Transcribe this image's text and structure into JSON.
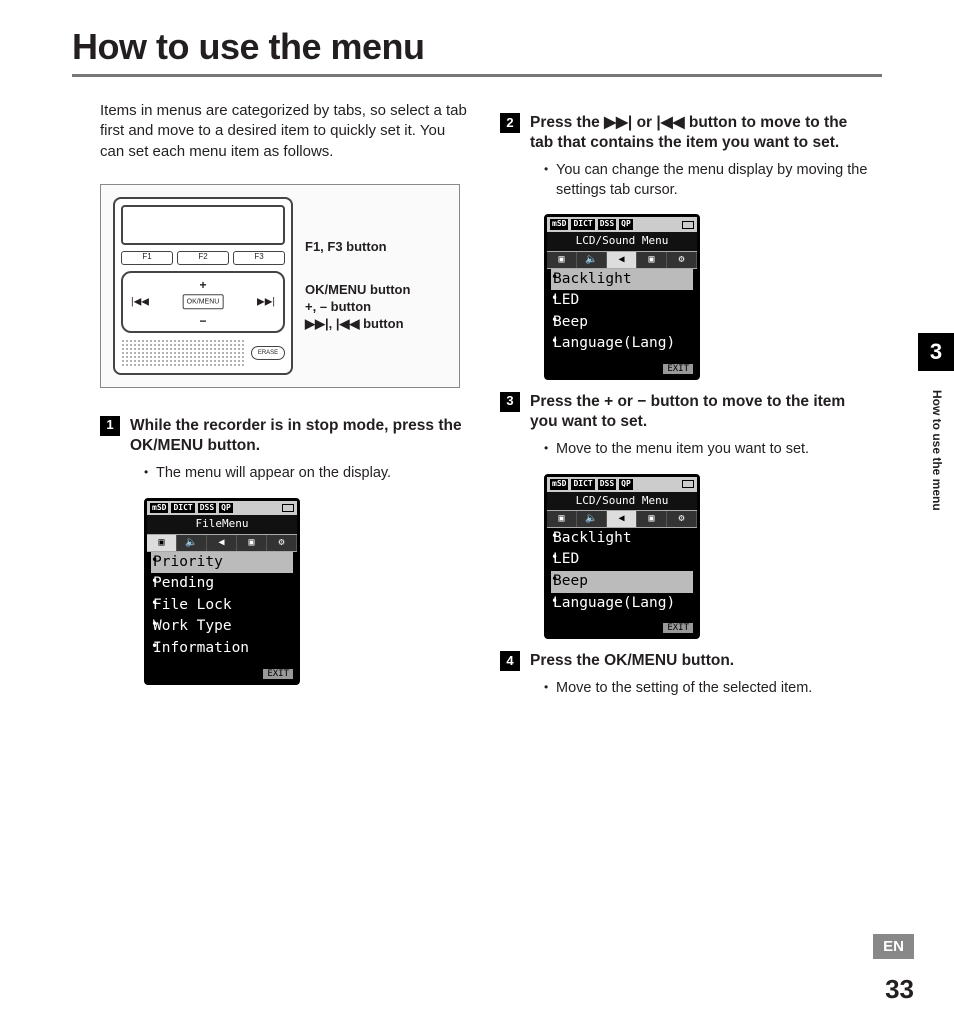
{
  "page_title": "How to use the menu",
  "intro": "Items in menus are categorized by tabs, so select a tab first and move to a desired item to quickly set it. You can set each menu item as follows.",
  "diagram": {
    "fkeys": [
      "F1",
      "F2",
      "F3"
    ],
    "ok_label": "OK/MENU",
    "erase_label": "ERASE",
    "callout1": "F1, F3 button",
    "callout2a": "OK/MENU button",
    "callout2b": "+, – button",
    "callout2c": "▶▶|, |◀◀ button"
  },
  "steps": [
    {
      "num": "1",
      "head": "While the recorder is in stop mode, press the OK/MENU button.",
      "bullet": "The menu will appear on the display.",
      "lcd": {
        "indicators": [
          "mSD",
          "DICT",
          "DSS",
          "QP"
        ],
        "title": "FileMenu",
        "tabs_sel": 0,
        "items": [
          "Priority",
          "Pending",
          "File Lock",
          "Work Type",
          "Information"
        ],
        "sel": 0,
        "exit": "EXIT"
      }
    },
    {
      "num": "2",
      "head": "Press the ▶▶| or |◀◀ button to move to the tab that contains the item you want to set.",
      "bullet": "You can change the menu display by moving the settings tab cursor.",
      "lcd": {
        "indicators": [
          "mSD",
          "DICT",
          "DSS",
          "QP"
        ],
        "title": "LCD/Sound Menu",
        "tabs_sel": 2,
        "items": [
          "Backlight",
          "LED",
          "Beep",
          "Language(Lang)"
        ],
        "sel": 0,
        "exit": "EXIT"
      }
    },
    {
      "num": "3",
      "head": "Press the + or − button to move to the item you want to set.",
      "bullet": "Move to the menu item you want to set.",
      "lcd": {
        "indicators": [
          "mSD",
          "DICT",
          "DSS",
          "QP"
        ],
        "title": "LCD/Sound Menu",
        "tabs_sel": 2,
        "items": [
          "Backlight",
          "LED",
          "Beep",
          "Language(Lang)"
        ],
        "sel": 2,
        "exit": "EXIT"
      }
    },
    {
      "num": "4",
      "head": "Press the OK/MENU button.",
      "bullet": "Move to the setting of the selected item."
    }
  ],
  "side": {
    "chapter": "3",
    "label": "How to use the menu"
  },
  "footer": {
    "lang": "EN",
    "page": "33"
  }
}
